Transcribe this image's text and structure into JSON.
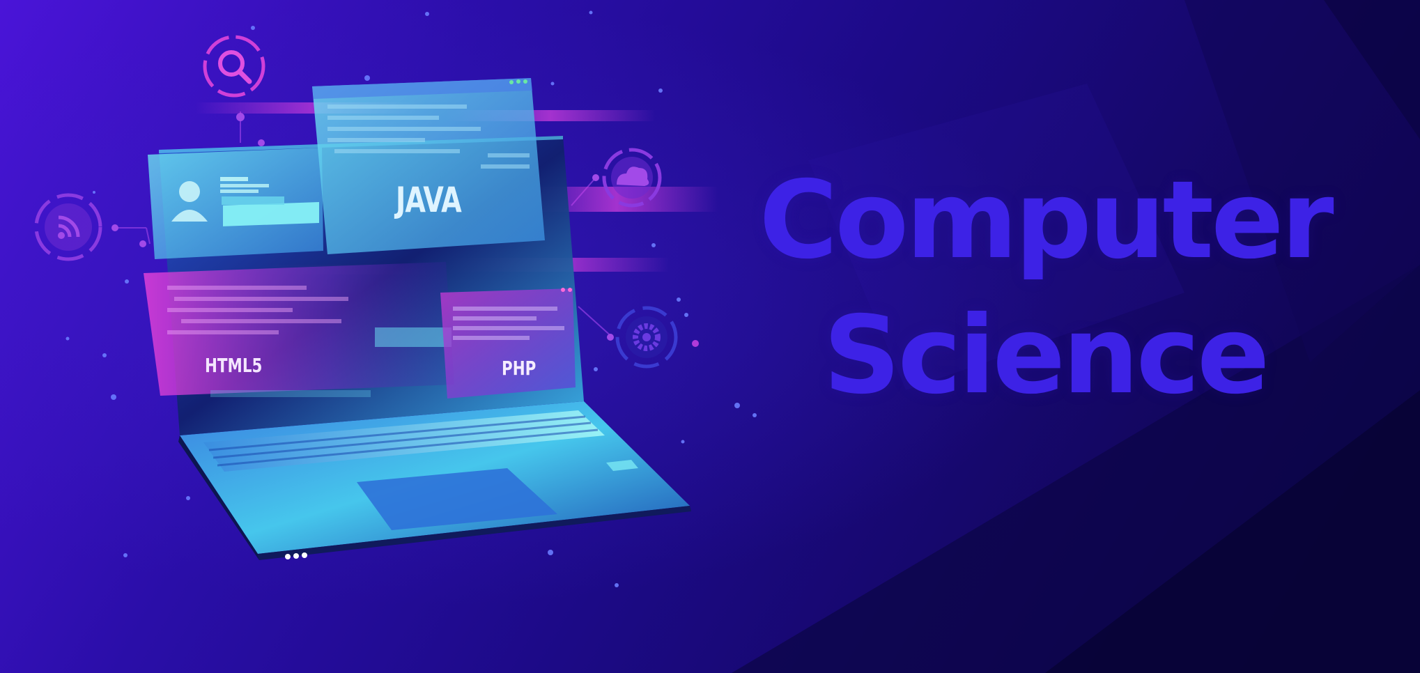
{
  "headline": {
    "line1": "Computer",
    "line2": "Science"
  },
  "panels": {
    "java": "JAVA",
    "html": "HTML5",
    "php": "PHP"
  },
  "icons": [
    "search-icon",
    "rss-icon",
    "cloud-icon",
    "gear-icon",
    "user-icon"
  ],
  "colors": {
    "background": "#1c0a86",
    "headline": "#3d22e6",
    "cyan": "#5fe0f0",
    "magenta": "#d040d8"
  }
}
